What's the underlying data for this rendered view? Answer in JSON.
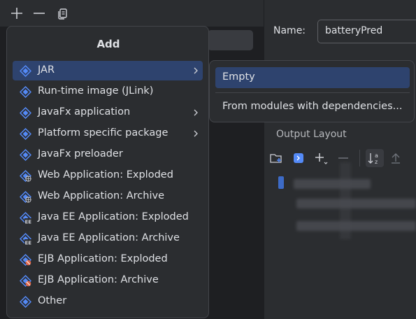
{
  "toolbar": {
    "icons": [
      "plus-icon",
      "minus-icon",
      "copy-icon"
    ]
  },
  "name_field": {
    "label": "Name:",
    "value": "batteryPred"
  },
  "output_layout": {
    "label": "Output Layout",
    "icons": [
      "new-folder-icon",
      "module-icon",
      "add-dropdown-icon",
      "remove-icon",
      "sort-alpha-icon",
      "move-up-icon"
    ]
  },
  "add_menu": {
    "title": "Add",
    "items": [
      {
        "label": "JAR",
        "icon": "jar-icon",
        "submenu": true,
        "selected": true
      },
      {
        "label": "Run-time image (JLink)",
        "icon": "artifact-icon",
        "submenu": false
      },
      {
        "label": "JavaFx application",
        "icon": "artifact-icon",
        "submenu": true
      },
      {
        "label": "Platform specific package",
        "icon": "artifact-icon",
        "submenu": true
      },
      {
        "label": "JavaFx preloader",
        "icon": "artifact-icon",
        "submenu": false
      },
      {
        "label": "Web Application: Exploded",
        "icon": "web-artifact-icon",
        "submenu": false
      },
      {
        "label": "Web Application: Archive",
        "icon": "web-artifact-icon",
        "submenu": false
      },
      {
        "label": "Java EE Application: Exploded",
        "icon": "javaee-artifact-icon",
        "submenu": false
      },
      {
        "label": "Java EE Application: Archive",
        "icon": "javaee-artifact-icon",
        "submenu": false
      },
      {
        "label": "EJB Application: Exploded",
        "icon": "ejb-artifact-icon",
        "submenu": false
      },
      {
        "label": "EJB Application: Archive",
        "icon": "ejb-artifact-icon",
        "submenu": false
      },
      {
        "label": "Other",
        "icon": "artifact-icon",
        "submenu": false
      }
    ]
  },
  "jar_submenu": {
    "items": [
      {
        "label": "Empty",
        "selected": true
      },
      {
        "label": "From modules with dependencies...",
        "selected": false
      }
    ]
  },
  "colors": {
    "background": "#1e1f22",
    "panel": "#2b2d30",
    "selection": "#2e436e",
    "icon_blue": "#548af7",
    "text": "#dfe1e5"
  }
}
